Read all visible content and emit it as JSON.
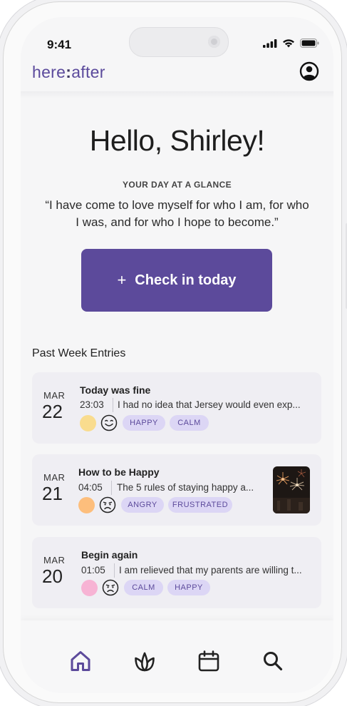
{
  "status_bar": {
    "time": "9:41"
  },
  "app": {
    "logo_left": "here",
    "logo_sep": ":",
    "logo_right": "after"
  },
  "greeting": "Hello, Shirley!",
  "glance_label": "YOUR DAY AT A GLANCE",
  "quote": "“I have come to love myself for who I am, for who I was, and for who I hope to become.”",
  "checkin": {
    "plus": "+",
    "label": "Check in today"
  },
  "past_week": {
    "title": "Past Week Entries",
    "entries": [
      {
        "month": "MAR",
        "day": "22",
        "title": "Today was fine",
        "time": "23:03",
        "snippet": "I had no idea that Jersey would even exp...",
        "mood_color": "#f9dc8e",
        "mood_face": "smile-face-icon",
        "tags": [
          "HAPPY",
          "CALM"
        ]
      },
      {
        "month": "MAR",
        "day": "21",
        "title": "How to be Happy",
        "time": "04:05",
        "snippet": "The 5 rules of staying happy a...",
        "mood_color": "#fdbe7c",
        "mood_face": "sad-face-icon",
        "tags": [
          "ANGRY",
          "FRUSTRATED"
        ]
      },
      {
        "month": "MAR",
        "day": "20",
        "title": "Begin again",
        "time": "01:05",
        "snippet": "I am relieved that my parents are willing t...",
        "mood_color": "#f7b3d4",
        "mood_face": "sad-face-icon",
        "tags": [
          "CALM",
          "HAPPY"
        ]
      }
    ]
  },
  "tabs": [
    "home-icon",
    "lotus-icon",
    "calendar-icon",
    "search-icon"
  ],
  "colors": {
    "accent": "#5c4a9b",
    "tag_bg": "#dcd6f5",
    "card_bg": "#efeef3"
  }
}
